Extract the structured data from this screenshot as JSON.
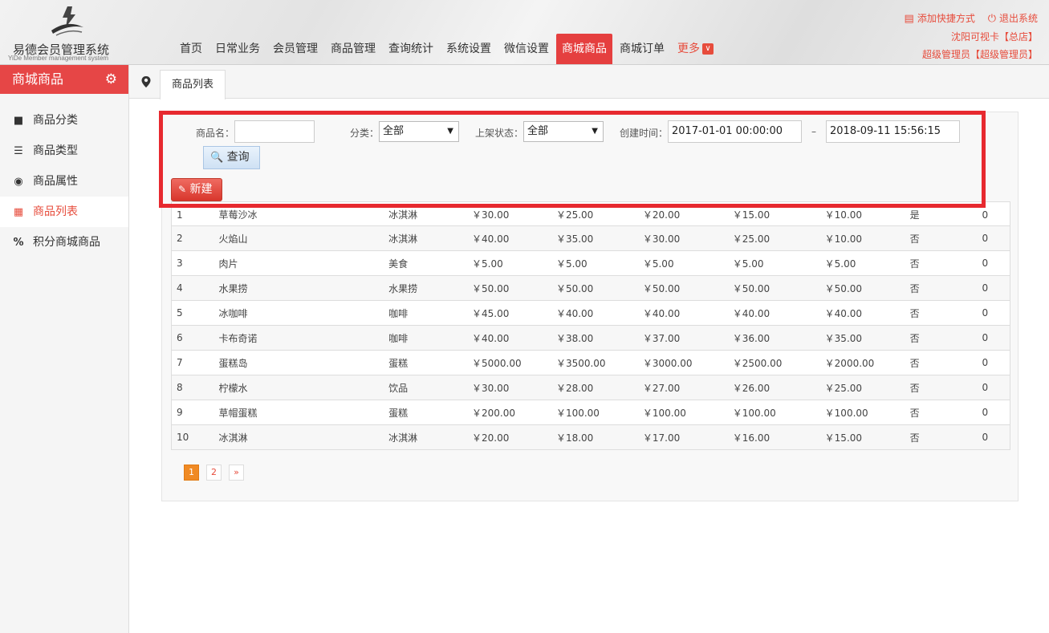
{
  "app": {
    "title": "易德会员管理系统",
    "subtitle": "YiDe Member management system"
  },
  "nav": {
    "items": [
      "首页",
      "日常业务",
      "会员管理",
      "商品管理",
      "查询统计",
      "系统设置",
      "微信设置",
      "商城商品",
      "商城订单"
    ],
    "active": "商城商品",
    "more": "更多"
  },
  "top_right": {
    "shortcut": "添加快捷方式",
    "logout": "退出系统",
    "store": "沈阳可视卡【总店】",
    "user": "超级管理员【超级管理员】"
  },
  "sidebar": {
    "title": "商城商品",
    "items": [
      {
        "label": "商品分类",
        "icon": "image-icon"
      },
      {
        "label": "商品类型",
        "icon": "list-icon"
      },
      {
        "label": "商品属性",
        "icon": "database-icon"
      },
      {
        "label": "商品列表",
        "icon": "grid-list-icon",
        "active": true
      },
      {
        "label": "积分商城商品",
        "icon": "percent-icon"
      }
    ]
  },
  "tabs": {
    "active_tab": "商品列表"
  },
  "filters": {
    "name_label": "商品名：",
    "name_value": "",
    "category_label": "分类：",
    "category_value": "全部",
    "status_label": "上架状态：",
    "status_value": "全部",
    "created_label": "创建时间：",
    "date_from": "2017-01-01 00:00:00",
    "date_sep": "–",
    "date_to": "2018-09-11 15:56:15",
    "query_button": "查询",
    "new_button": "新建"
  },
  "table": {
    "rows": [
      [
        "1",
        "草莓沙冰",
        "冰淇淋",
        "￥30.00",
        "￥25.00",
        "￥20.00",
        "￥15.00",
        "￥10.00",
        "是",
        "0"
      ],
      [
        "2",
        "火焰山",
        "冰淇淋",
        "￥40.00",
        "￥35.00",
        "￥30.00",
        "￥25.00",
        "￥10.00",
        "否",
        "0"
      ],
      [
        "3",
        "肉片",
        "美食",
        "￥5.00",
        "￥5.00",
        "￥5.00",
        "￥5.00",
        "￥5.00",
        "否",
        "0"
      ],
      [
        "4",
        "水果捞",
        "水果捞",
        "￥50.00",
        "￥50.00",
        "￥50.00",
        "￥50.00",
        "￥50.00",
        "否",
        "0"
      ],
      [
        "5",
        "冰咖啡",
        "咖啡",
        "￥45.00",
        "￥40.00",
        "￥40.00",
        "￥40.00",
        "￥40.00",
        "否",
        "0"
      ],
      [
        "6",
        "卡布奇诺",
        "咖啡",
        "￥40.00",
        "￥38.00",
        "￥37.00",
        "￥36.00",
        "￥35.00",
        "否",
        "0"
      ],
      [
        "7",
        "蛋糕岛",
        "蛋糕",
        "￥5000.00",
        "￥3500.00",
        "￥3000.00",
        "￥2500.00",
        "￥2000.00",
        "否",
        "0"
      ],
      [
        "8",
        "柠檬水",
        "饮品",
        "￥30.00",
        "￥28.00",
        "￥27.00",
        "￥26.00",
        "￥25.00",
        "否",
        "0"
      ],
      [
        "9",
        "草帽蛋糕",
        "蛋糕",
        "￥200.00",
        "￥100.00",
        "￥100.00",
        "￥100.00",
        "￥100.00",
        "否",
        "0"
      ],
      [
        "10",
        "冰淇淋",
        "冰淇淋",
        "￥20.00",
        "￥18.00",
        "￥17.00",
        "￥16.00",
        "￥15.00",
        "否",
        "0"
      ]
    ]
  },
  "pagination": {
    "pages": [
      "1",
      "2"
    ],
    "current": "1",
    "next": "»"
  },
  "colors": {
    "accent": "#e53f3f",
    "highlight_border": "#e7292f",
    "page_active": "#f08a24"
  }
}
